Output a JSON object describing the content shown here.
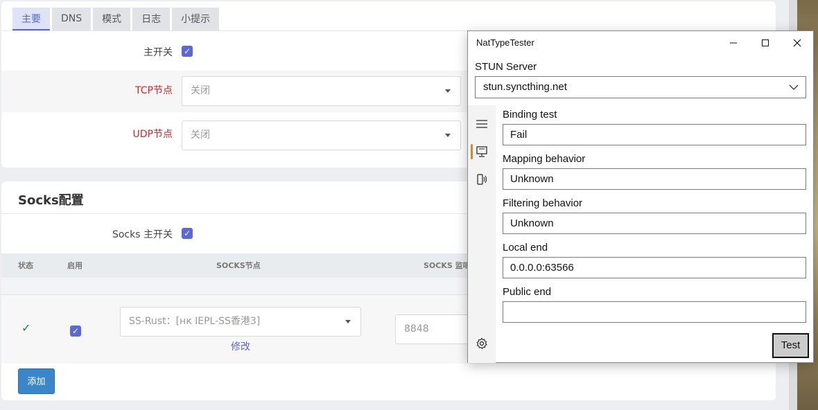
{
  "web": {
    "tabs": [
      "主要",
      "DNS",
      "模式",
      "日志",
      "小提示"
    ],
    "main_switch_label": "主开关",
    "tcp_label": "TCP节点",
    "tcp_value": "关闭",
    "udp_label": "UDP节点",
    "udp_value": "关闭",
    "socks_title": "Socks配置",
    "socks_switch_label": "Socks 主开关",
    "table_headers": {
      "status": "状态",
      "enabled": "启用",
      "node": "SOCKS节点",
      "port": "SOCKS 监听"
    },
    "row": {
      "status": "✓",
      "node_value": "SS-Rust：[нк IEPL-SS香港3]",
      "edit_link": "修改",
      "port_value": "8848"
    },
    "add_button": "添加"
  },
  "app": {
    "title": "NatTypeTester",
    "stun_label": "STUN Server",
    "stun_value": "stun.syncthing.net",
    "binding_label": "Binding test",
    "binding_value": "Fail",
    "mapping_label": "Mapping behavior",
    "mapping_value": "Unknown",
    "filtering_label": "Filtering behavior",
    "filtering_value": "Unknown",
    "local_label": "Local end",
    "local_value": "0.0.0.0:63566",
    "public_label": "Public end",
    "public_value": "",
    "test_button": "Test"
  },
  "colors": {
    "accent": "#5b68d6",
    "required": "#e02020",
    "add_button": "#3a86c8",
    "nav_indicator": "#d08a2b"
  },
  "icons": [
    "hamburger-icon",
    "monitor-icon",
    "phone-signal-icon",
    "gear-icon",
    "minimize-icon",
    "maximize-icon",
    "close-icon",
    "chevron-down-icon"
  ]
}
